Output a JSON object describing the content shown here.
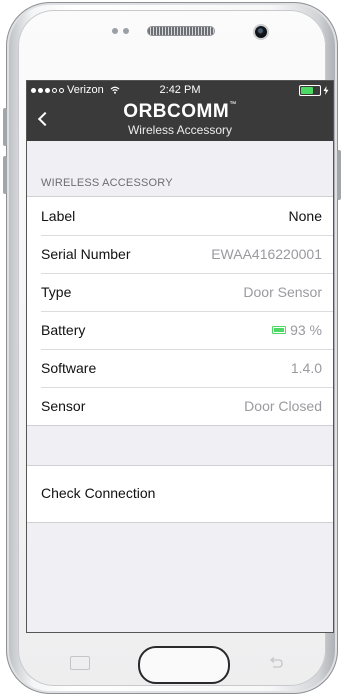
{
  "status_bar": {
    "carrier": "Verizon",
    "time": "2:42 PM"
  },
  "nav": {
    "logo_text": "ORBCOMM",
    "logo_trademark": "™",
    "subtitle": "Wireless Accessory"
  },
  "section": {
    "header": "WIRELESS ACCESSORY"
  },
  "rows": [
    {
      "label": "Label",
      "value": "None"
    },
    {
      "label": "Serial Number",
      "value": "EWAA416220001"
    },
    {
      "label": "Type",
      "value": "Door Sensor"
    },
    {
      "label": "Battery",
      "value": "93 %"
    },
    {
      "label": "Software",
      "value": "1.4.0"
    },
    {
      "label": "Sensor",
      "value": "Door Closed"
    }
  ],
  "action": {
    "label": "Check Connection"
  },
  "colors": {
    "bar_bg": "#3a3a3b",
    "battery_green": "#4cd964",
    "value_gray": "#9a9a9f",
    "screen_bg": "#efeff4"
  }
}
